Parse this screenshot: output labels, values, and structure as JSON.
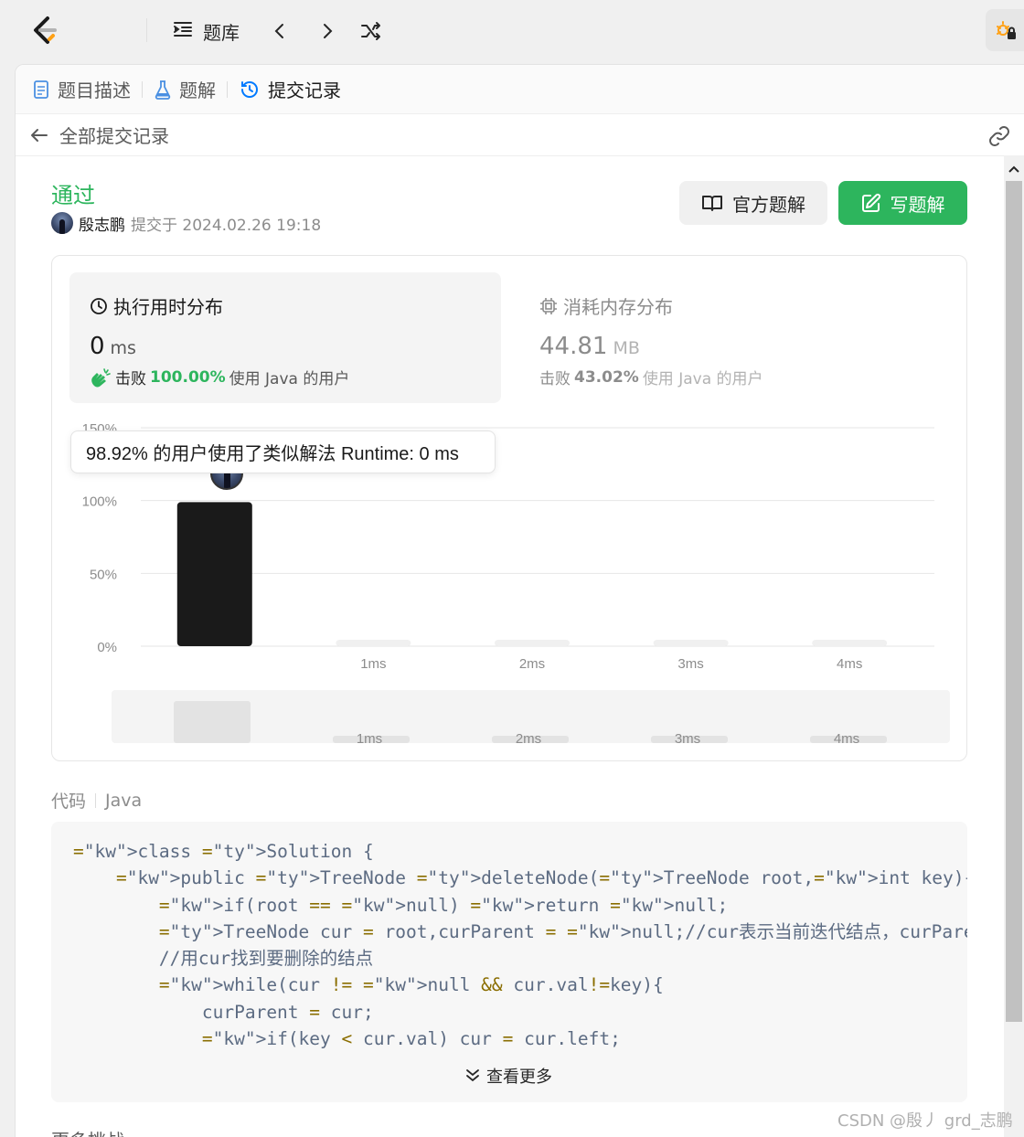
{
  "topbar": {
    "problems_label": "题库"
  },
  "tabs": [
    {
      "label": "题目描述"
    },
    {
      "label": "题解"
    },
    {
      "label": "提交记录"
    }
  ],
  "subheader": {
    "title": "全部提交记录"
  },
  "submission": {
    "status": "通过",
    "author": "殷志鹏",
    "submitted_text": "提交于 2024.02.26 19:18",
    "official_button": "官方题解",
    "write_button": "写题解"
  },
  "runtime": {
    "title": "执行用时分布",
    "value": "0",
    "unit": "ms",
    "beat_label": "击败",
    "beat_pct": "100.00%",
    "beat_suffix": "使用 Java 的用户"
  },
  "memory": {
    "title": "消耗内存分布",
    "value": "44.81",
    "unit": "MB",
    "beat_label": "击败",
    "beat_pct": "43.02%",
    "beat_suffix": "使用 Java 的用户"
  },
  "tooltip": "98.92% 的用户使用了类似解法 Runtime: 0 ms",
  "chart_data": {
    "type": "bar",
    "categories": [
      "0ms",
      "1ms",
      "2ms",
      "3ms",
      "4ms"
    ],
    "x_tick_labels": [
      "",
      "1ms",
      "2ms",
      "3ms",
      "4ms"
    ],
    "values": [
      98.92,
      0.3,
      0.2,
      0.2,
      0.2
    ],
    "y_ticks": [
      "0%",
      "50%",
      "100%",
      "150%"
    ],
    "ylim": [
      0,
      150
    ],
    "highlight_index": 0,
    "colors": {
      "active": "#1a1a1a",
      "inactive": "#f0f0f0",
      "grid": "#e6e6e6"
    }
  },
  "code": {
    "label": "代码",
    "language": "Java",
    "lines": [
      "class Solution {",
      "    public TreeNode deleteNode(TreeNode root,int key){",
      "        if(root == null) return null;",
      "        TreeNode cur = root,curParent = null;//cur表示当前迭代结点，curParent是cur的父",
      "        //用cur找到要删除的结点",
      "        while(cur != null && cur.val!=key){",
      "            curParent = cur;",
      "            if(key < cur.val) cur = cur.left;"
    ],
    "more_label": "查看更多"
  },
  "cutoff_text": "更多挑战",
  "watermark": "CSDN @殷丿 grd_志鹏",
  "colors": {
    "accent_green": "#2db55d",
    "link_blue": "#007aff"
  }
}
